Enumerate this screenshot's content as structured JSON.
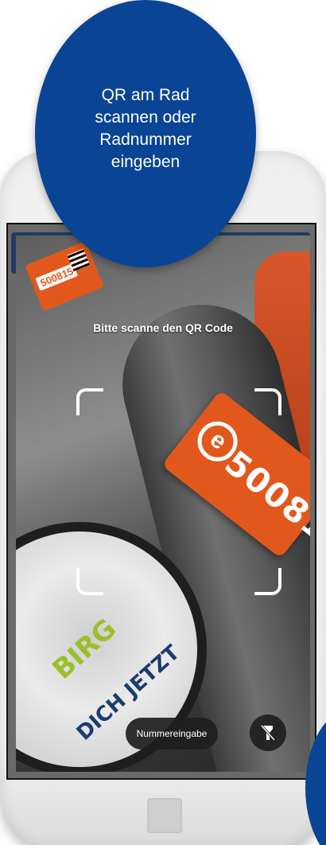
{
  "callout": {
    "line1": "QR am Rad",
    "line2": "scannen oder",
    "line3": "Radnummer",
    "line4": "eingeben"
  },
  "scanner": {
    "title": "Bitte scanne den QR Code",
    "manual_entry_label": "Nummereingabe",
    "flash_icon": "flashlight-off-icon"
  },
  "camera_view": {
    "plate_number": "50081",
    "sticker_number": "500815",
    "wheel_text_1": "BIRG",
    "wheel_text_2": "DICH JETZT"
  },
  "colors": {
    "callout_blue": "#0a4495",
    "bike_orange": "#e2581c",
    "button_dark": "#1e1e1e"
  }
}
